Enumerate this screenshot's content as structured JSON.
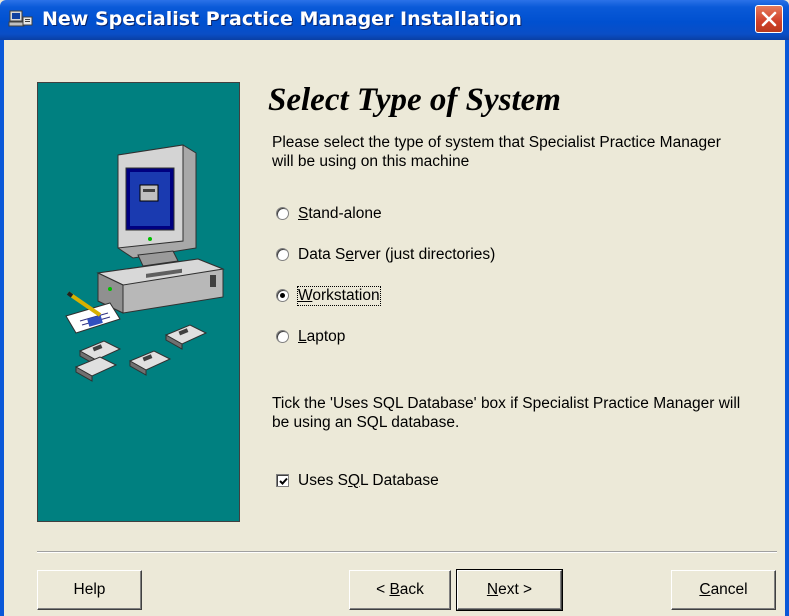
{
  "window": {
    "title": "New Specialist Practice Manager Installation"
  },
  "icons": {
    "title_icon": "installer-icon",
    "close": "close-icon",
    "illustration": "computer-with-disks-illustration"
  },
  "colors": {
    "titlebar": "#0050d0",
    "panel": "#008080",
    "dialog_bg": "#ece9d8",
    "close": "#d0402a"
  },
  "page": {
    "heading": "Select Type of System",
    "instructions": "Please select the type of system that Specialist Practice Manager will be using on this machine",
    "sql_instructions": "Tick the 'Uses SQL Database' box if Specialist Practice Manager will be using an SQL database."
  },
  "system_types": {
    "selected": "Workstation",
    "options": [
      {
        "label_pre": "",
        "label_u": "S",
        "label_post": "tand-alone",
        "selected": false
      },
      {
        "label_pre": "Data S",
        "label_u": "e",
        "label_post": "rver (just directories)",
        "selected": false
      },
      {
        "label_pre": "",
        "label_u": "W",
        "label_post": "orkstation",
        "selected": true
      },
      {
        "label_pre": "",
        "label_u": "L",
        "label_post": "aptop",
        "selected": false
      }
    ]
  },
  "sql_checkbox": {
    "label_pre": "Uses S",
    "label_u": "Q",
    "label_post": "L Database",
    "checked": true
  },
  "buttons": {
    "help": "Help",
    "back_pre": "< ",
    "back_u": "B",
    "back_post": "ack",
    "next_u": "N",
    "next_post": "ext >",
    "cancel_u": "C",
    "cancel_post": "ancel"
  }
}
